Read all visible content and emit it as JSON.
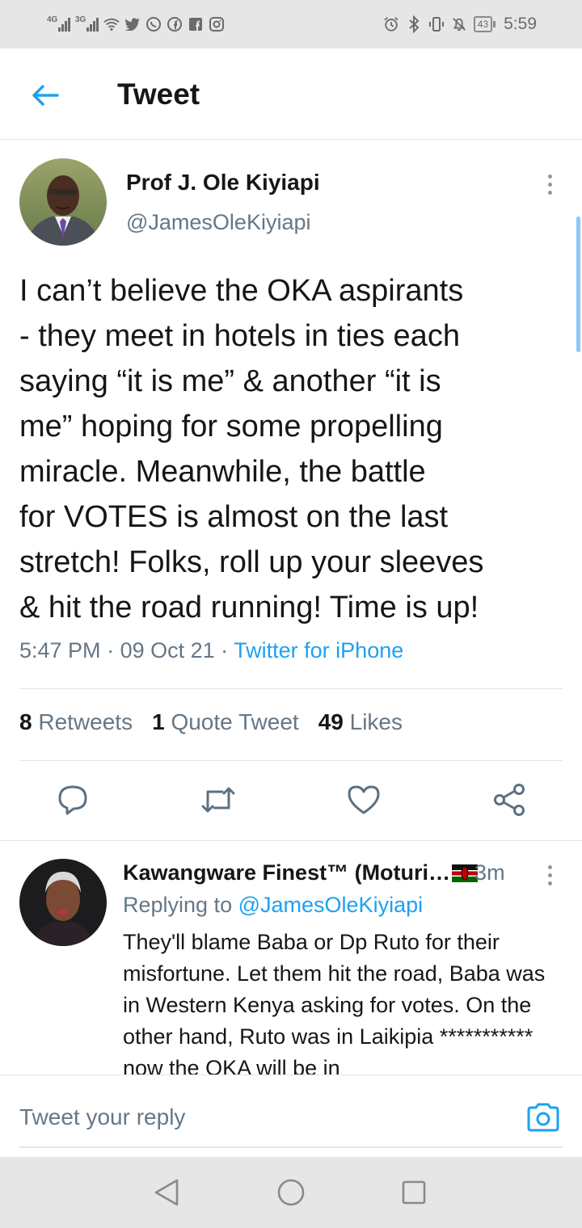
{
  "status_bar": {
    "network_1": "4G",
    "network_2": "3G",
    "battery": "43",
    "time": "5:59",
    "icons": [
      "signal-icon",
      "wifi-icon",
      "twitter-icon",
      "whatsapp-icon",
      "facebook-icon",
      "facebook-square-icon",
      "instagram-icon",
      "alarm-icon",
      "bluetooth-icon",
      "vibrate-icon",
      "mute-icon"
    ]
  },
  "header": {
    "title": "Tweet",
    "back_icon": "arrow-left-icon"
  },
  "tweet": {
    "author_name": "Prof J. Ole Kiyiapi",
    "author_handle": "@JamesOleKiyiapi",
    "text": "I can’t believe the OKA aspirants\n- they meet in hotels in ties each\nsaying “it is me” & another “it is\nme” hoping for some propelling\nmiracle. Meanwhile, the battle\nfor VOTES is  almost on the last\nstretch! Folks, roll up your sleeves\n& hit the road running! Time is up!",
    "time": "5:47 PM",
    "date": "09 Oct 21",
    "source": "Twitter for iPhone",
    "retweets_count": "8",
    "retweets_label": "Retweets",
    "quotes_count": "1",
    "quotes_label": "Quote Tweet",
    "likes_count": "49",
    "likes_label": "Likes",
    "actions": [
      "reply-icon",
      "retweet-icon",
      "like-icon",
      "share-icon"
    ]
  },
  "reply": {
    "author_name": "Kawangware Finest™ (Moturi…",
    "time": "3m",
    "replying_label": "Replying to",
    "replying_to": "@JamesOleKiyiapi",
    "text": "They'll blame Baba or Dp Ruto for their misfortune. Let them hit the road, Baba was in Western Kenya asking for votes. On the other hand, Ruto was in Laikipia ***********  now the OKA will be in"
  },
  "compose": {
    "placeholder": "Tweet your reply"
  },
  "colors": {
    "accent": "#1da1f2",
    "text": "#14171a",
    "secondary": "#657786"
  }
}
